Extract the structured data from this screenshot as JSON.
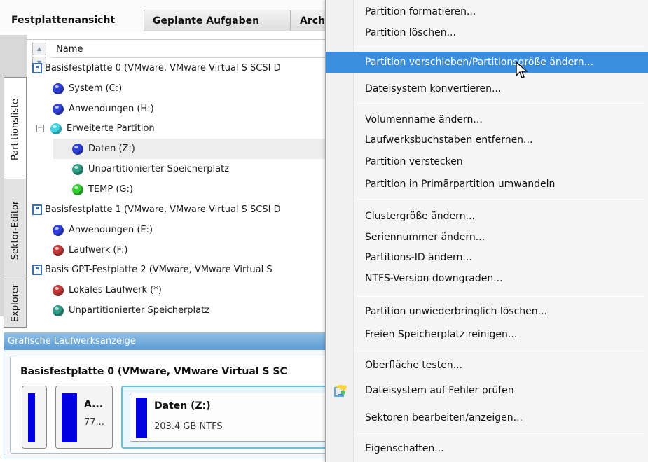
{
  "top_tabs": [
    "Festplattenansicht",
    "Geplante Aufgaben",
    "Arch"
  ],
  "side_tabs": [
    "Partitionsliste",
    "Sektor-Editor",
    "Explorer"
  ],
  "tree": {
    "column_header": "Name",
    "rows": [
      {
        "label": "Basisfestplatte 0 (VMware, VMware Virtual S SCSI D",
        "type": "disk"
      },
      {
        "label": "System (C:)",
        "type": "partition",
        "color": "#2d3fd6"
      },
      {
        "label": "Anwendungen (H:)",
        "type": "partition",
        "color": "#2d3fd6"
      },
      {
        "label": "Erweiterte Partition",
        "type": "extended",
        "color": "#3fd3e0"
      },
      {
        "label": "Daten (Z:)",
        "type": "partition",
        "color": "#2d3fd6"
      },
      {
        "label": "Unpartitionierter Speicherplatz",
        "type": "partition",
        "color": "#2f9a86"
      },
      {
        "label": "TEMP (G:)",
        "type": "partition",
        "color": "#33cc33"
      },
      {
        "label": "Basisfestplatte 1 (VMware, VMware Virtual S SCSI D",
        "type": "disk"
      },
      {
        "label": "Anwendungen (E:)",
        "type": "partition",
        "color": "#2d3fd6"
      },
      {
        "label": "Laufwerk (F:)",
        "type": "partition",
        "color": "#c23a3a"
      },
      {
        "label": "Basis GPT-Festplatte 2 (VMware, VMware Virtual S",
        "type": "disk"
      },
      {
        "label": "Lokales Laufwerk (*)",
        "type": "partition",
        "color": "#c23a3a"
      },
      {
        "label": "Unpartitionierter Speicherplatz",
        "type": "partition",
        "color": "#2f9a86"
      }
    ]
  },
  "graphic_view": {
    "title": "Grafische Laufwerksanzeige",
    "disk_name": "Basisfestplatte 0 (VMware, VMware Virtual S SC",
    "part_small_name": "A...",
    "part_small_size": "77...",
    "part_selected_name": "Daten (Z:)",
    "part_selected_info": "203.4 GB NTFS"
  },
  "menu": {
    "items": [
      "Partition formatieren...",
      "Partition löschen...",
      "Partition verschieben/Partitionsgröße ändern...",
      "Dateisystem konvertieren...",
      "Volumenname ändern...",
      "Laufwerksbuchstaben entfernen...",
      "Partition verstecken",
      "Partition in Primärpartition umwandeln",
      "Clustergröße ändern...",
      "Seriennummer ändern...",
      "Partitions-ID ändern...",
      "NTFS-Version downgraden...",
      "Partition unwiederbringlich löschen...",
      "Freien Speicherplatz reinigen...",
      "Oberfläche testen...",
      "Dateisystem auf Fehler prüfen",
      "Sektoren bearbeiten/anzeigen...",
      "Eigenschaften..."
    ],
    "highlighted_index": 2,
    "icon_item": "check-filesystem-icon"
  }
}
